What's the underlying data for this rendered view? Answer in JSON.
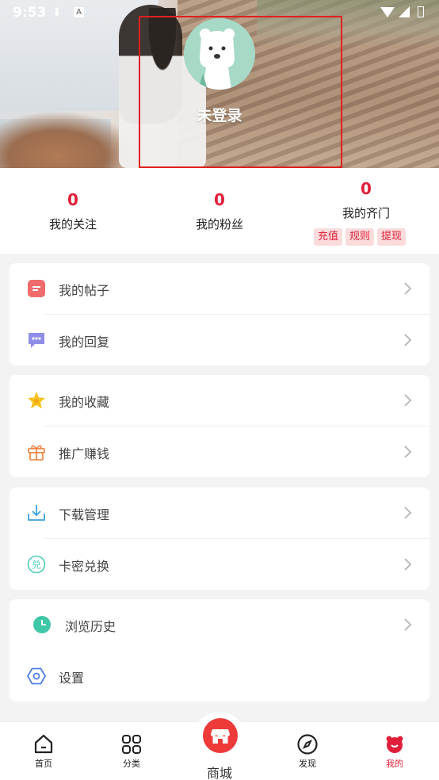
{
  "status_bar": {
    "time": "9:53"
  },
  "profile": {
    "login_text": "未登录"
  },
  "stats": [
    {
      "value": "0",
      "label": "我的关注"
    },
    {
      "value": "0",
      "label": "我的粉丝"
    },
    {
      "value": "0",
      "label": "我的齐门"
    }
  ],
  "tags": [
    "充值",
    "规则",
    "提现"
  ],
  "menu": {
    "posts": "我的帖子",
    "replies": "我的回复",
    "favorites": "我的收藏",
    "promote": "推广赚钱",
    "downloads": "下载管理",
    "redeem": "卡密兑换",
    "history": "浏览历史",
    "settings": "设置"
  },
  "nav": {
    "home": "首页",
    "category": "分类",
    "shop": "商城",
    "discover": "发现",
    "mine": "我的"
  },
  "colors": {
    "accent": "#e0203a",
    "shop_button": "#ef3a3a",
    "tag_bg": "#fbdcdc"
  }
}
